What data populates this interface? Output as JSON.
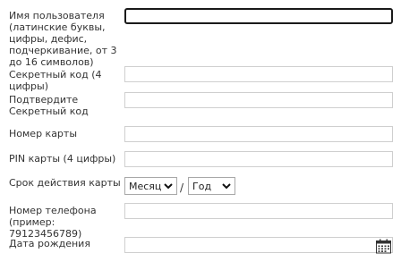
{
  "form": {
    "username": {
      "label": "Имя пользователя (латинские буквы, цифры, дефис, подчеркивание, от 3 до 16 символов)",
      "value": ""
    },
    "secret_code": {
      "label": "Секретный код (4 цифры)",
      "value": ""
    },
    "confirm_secret": {
      "label": "Подтвердите Секретный код",
      "value": ""
    },
    "card_number": {
      "label": "Номер карты",
      "value": ""
    },
    "pin": {
      "label": "PIN карты (4 цифры)",
      "value": ""
    },
    "card_expiry": {
      "label": "Срок действия карты",
      "month_selected": "Месяц",
      "separator": "/",
      "year_selected": "Год"
    },
    "phone": {
      "label": "Номер телефона (пример: 79123456789)",
      "value": ""
    },
    "birth_date": {
      "label": "Дата рождения",
      "value": "",
      "icon": "calendar-icon"
    }
  },
  "colors": {
    "focus_border": "#1a1a1a",
    "field_border": "#cfcfcf",
    "text": "#333333"
  }
}
